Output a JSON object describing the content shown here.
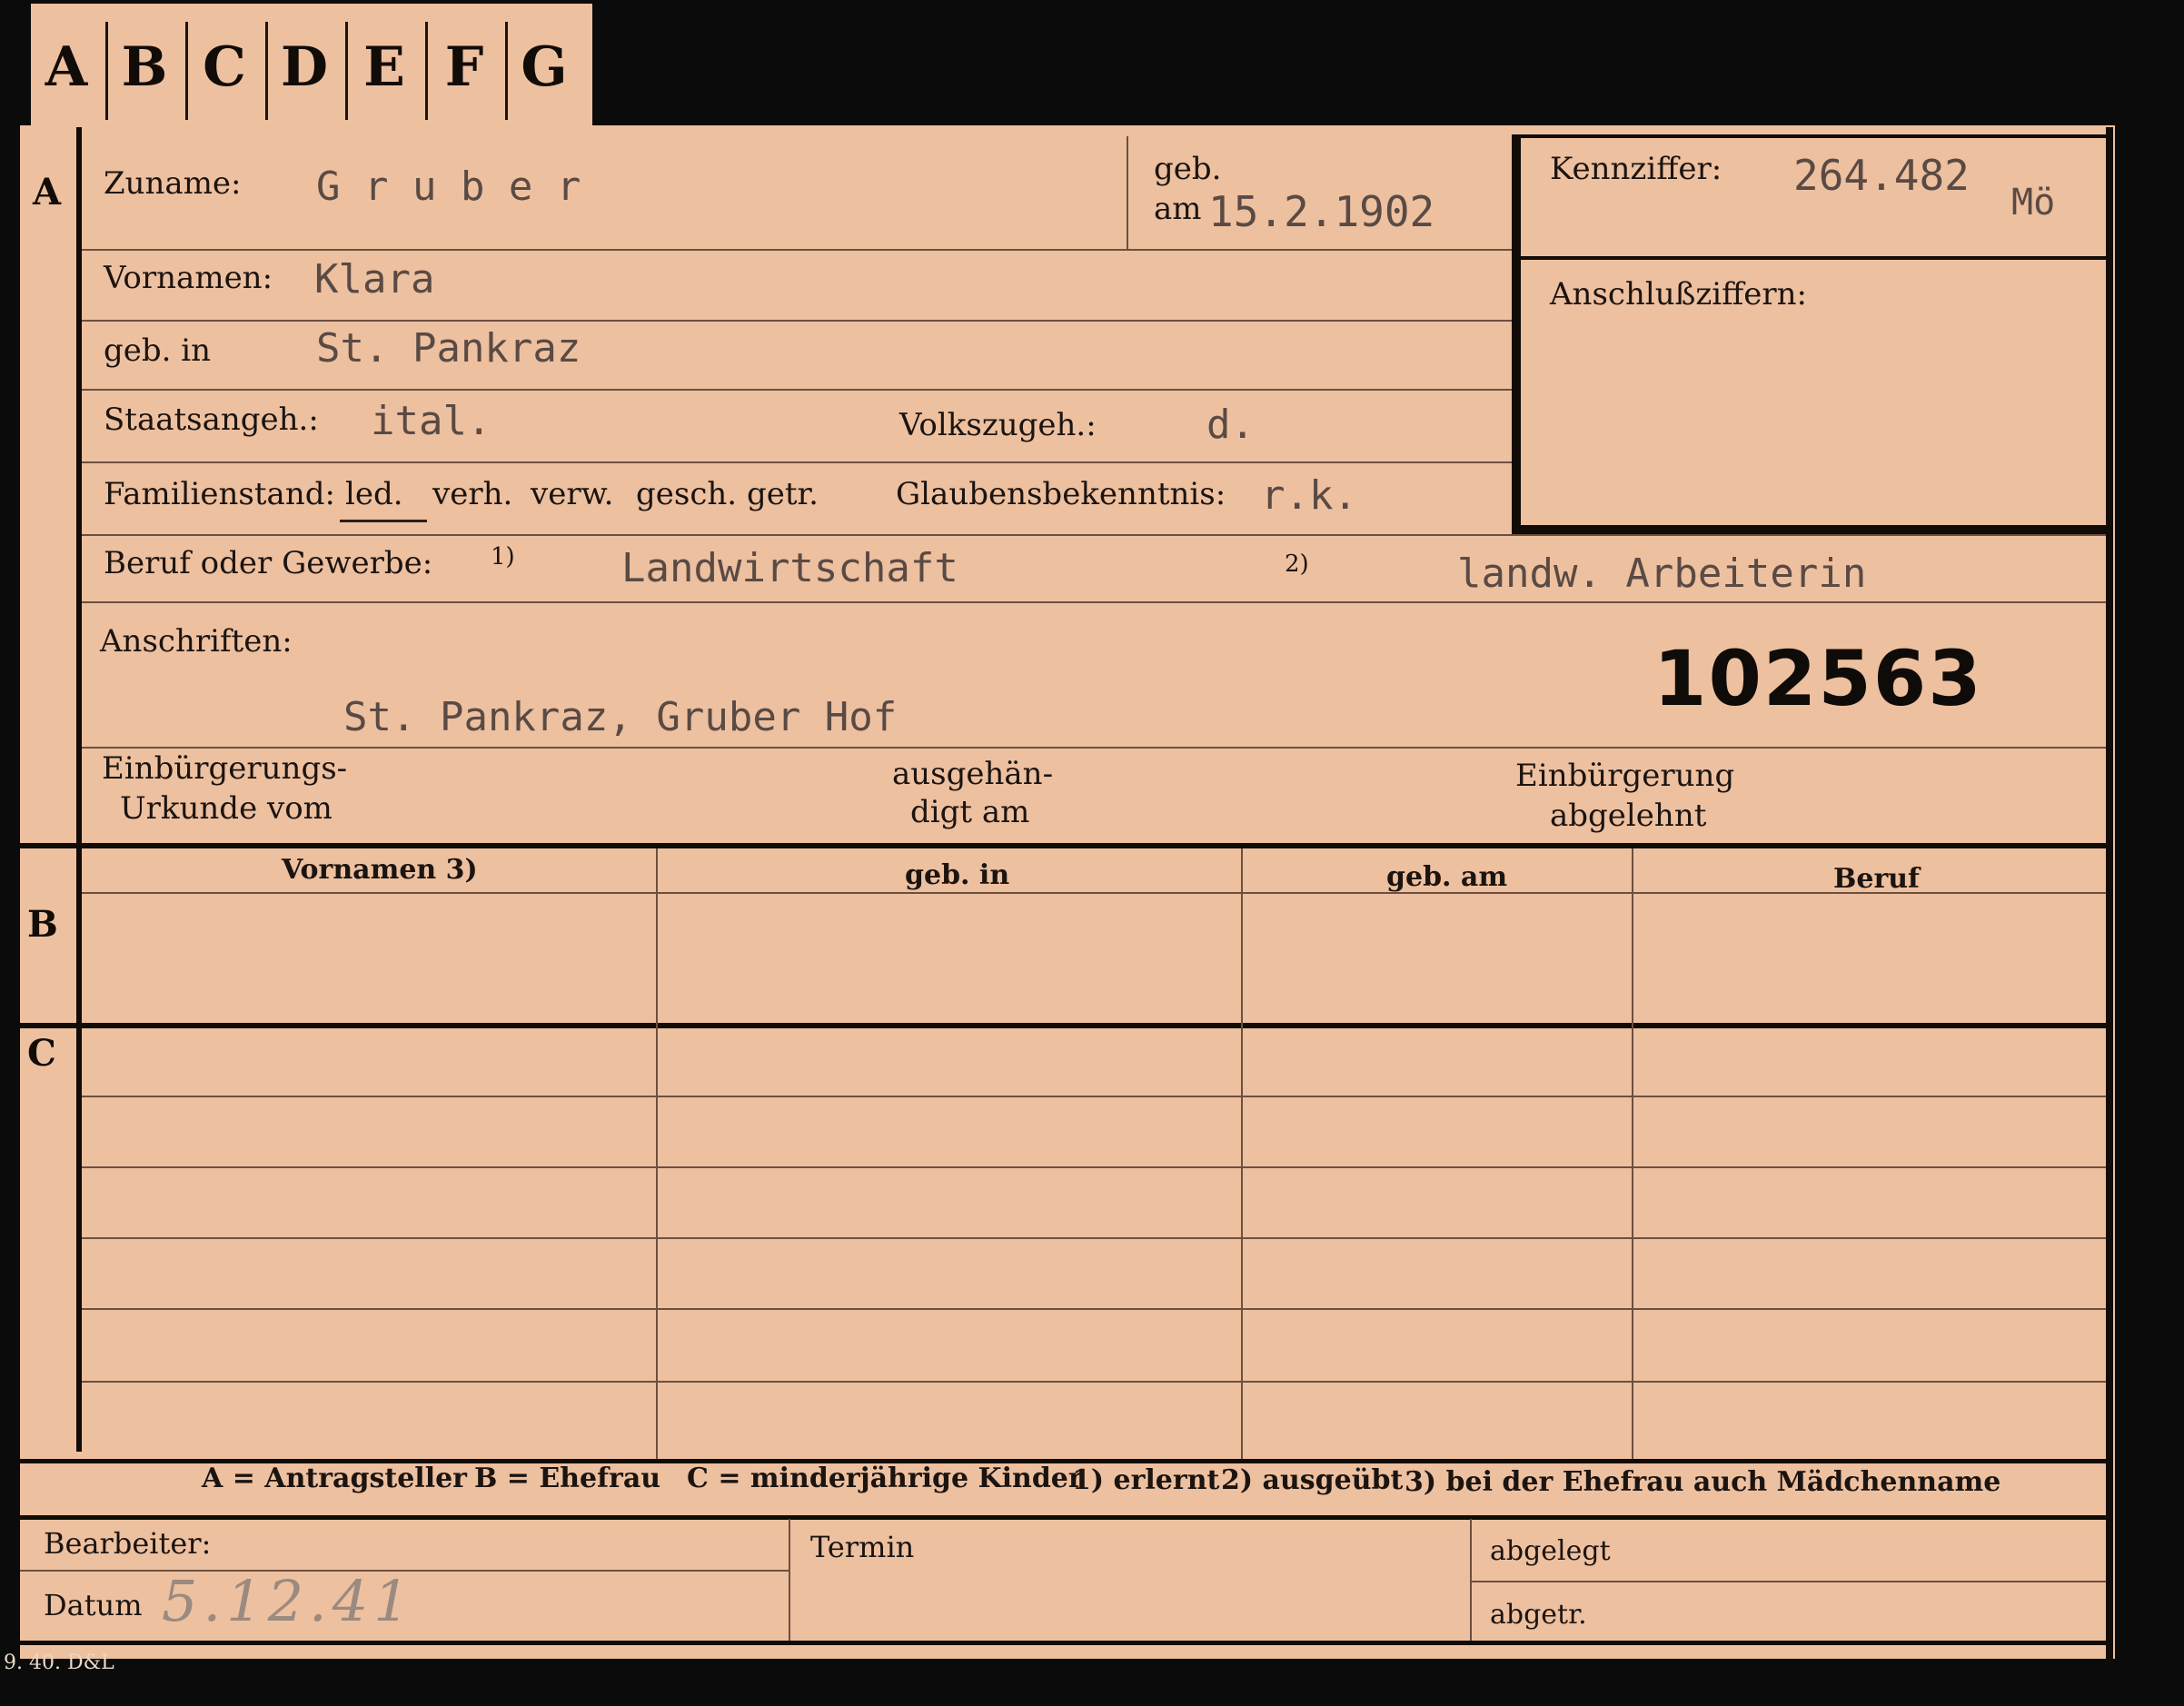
{
  "tabs": [
    "A",
    "B",
    "C",
    "D",
    "E",
    "F",
    "G"
  ],
  "section_a": {
    "marker": "A",
    "surname_label": "Zuname:",
    "surname_value": "G r u b e r",
    "born_label_1": "geb.",
    "born_label_2": "am",
    "born_value": "15.2.1902",
    "first_names_label": "Vornamen:",
    "first_names_value": "Klara",
    "birthplace_label": "geb. in",
    "birthplace_value": "St. Pankraz",
    "citizenship_label": "Staatsangeh.:",
    "citizenship_value": "ital.",
    "ethnicity_label": "Volkszugeh.:",
    "ethnicity_value": "d.",
    "marital_label": "Familienstand:",
    "marital_options": [
      "led.",
      "verh.",
      "verw.",
      "gesch.",
      "getr."
    ],
    "religion_label": "Glaubensbekenntnis:",
    "religion_value": "r.k.",
    "occupation_label": "Beruf oder Gewerbe:",
    "occupation_note_1": "1)",
    "occupation_value_1": "Landwirtschaft",
    "occupation_note_2": "2)",
    "occupation_value_2": "landw. Arbeiterin",
    "address_label": "Anschriften:",
    "address_value": "St. Pankraz, Gruber Hof",
    "stamp_number": "102563",
    "naturalization_doc_label_1": "Einbürgerungs-",
    "naturalization_doc_label_2": "Urkunde vom",
    "issued_label_1": "ausgehän-",
    "issued_label_2": "digt am",
    "rejected_label_1": "Einbürgerung",
    "rejected_label_2": "abgelehnt"
  },
  "id_box": {
    "code_label": "Kennziffer:",
    "code_value": "264.482",
    "code_suffix": "Mö",
    "follow_label": "Anschlußziffern:"
  },
  "section_b": {
    "marker": "B",
    "headers": [
      "Vornamen 3)",
      "geb. in",
      "geb. am",
      "Beruf"
    ]
  },
  "section_c": {
    "marker": "C"
  },
  "legend": {
    "a": "A = Antragsteller",
    "b": "B = Ehefrau",
    "c": "C = minderjährige Kinder",
    "n1": "1) erlernt",
    "n2": "2) ausgeübt",
    "n3": "3) bei der Ehefrau auch Mädchenname"
  },
  "footer": {
    "clerk_label": "Bearbeiter:",
    "date_label": "Datum",
    "date_value": "5.12.41",
    "deadline_label": "Termin",
    "filed_label": "abgelegt",
    "removed_label": "abgetr.",
    "print_code": "9. 40. D&L"
  }
}
